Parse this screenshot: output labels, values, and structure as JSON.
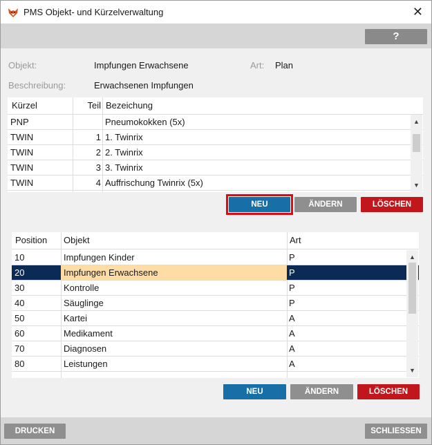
{
  "window": {
    "title": "PMS Objekt- und Kürzelverwaltung",
    "app_icon": "fox-icon",
    "close_label": "✕"
  },
  "toolbar": {
    "help_label": "?"
  },
  "info": {
    "objekt_label": "Objekt:",
    "objekt_value": "Impfungen Erwachsene",
    "art_label": "Art:",
    "art_value": "Plan",
    "beschreibung_label": "Beschreibung:",
    "beschreibung_value": "Erwachsenen Impfungen"
  },
  "kuerzel_table": {
    "columns": {
      "kuerzel": "Kürzel",
      "teil": "Teil",
      "bezeichung": "Bezeichung"
    },
    "rows": [
      {
        "kuerzel": "PNP",
        "teil": "",
        "bezeichung": "Pneumokokken (5x)"
      },
      {
        "kuerzel": "TWIN",
        "teil": "1",
        "bezeichung": "1. Twinrix"
      },
      {
        "kuerzel": "TWIN",
        "teil": "2",
        "bezeichung": "2. Twinrix"
      },
      {
        "kuerzel": "TWIN",
        "teil": "3",
        "bezeichung": "3. Twinrix"
      },
      {
        "kuerzel": "TWIN",
        "teil": "4",
        "bezeichung": "Auffrischung Twinrix (5x)"
      }
    ],
    "buttons": {
      "new": "NEU",
      "edit": "ÄNDERN",
      "delete": "LÖSCHEN"
    }
  },
  "objekt_table": {
    "columns": {
      "position": "Position",
      "objekt": "Objekt",
      "art": "Art"
    },
    "rows": [
      {
        "position": "10",
        "objekt": "Impfungen Kinder",
        "art": "P",
        "selected": false
      },
      {
        "position": "20",
        "objekt": "Impfungen Erwachsene",
        "art": "P",
        "selected": true
      },
      {
        "position": "30",
        "objekt": "Kontrolle",
        "art": "P",
        "selected": false
      },
      {
        "position": "40",
        "objekt": "Säuglinge",
        "art": "P",
        "selected": false
      },
      {
        "position": "50",
        "objekt": "Kartei",
        "art": "A",
        "selected": false
      },
      {
        "position": "60",
        "objekt": "Medikament",
        "art": "A",
        "selected": false
      },
      {
        "position": "70",
        "objekt": "Diagnosen",
        "art": "A",
        "selected": false
      },
      {
        "position": "80",
        "objekt": "Leistungen",
        "art": "A",
        "selected": false
      }
    ],
    "buttons": {
      "new": "NEU",
      "edit": "ÄNDERN",
      "delete": "LÖSCHEN"
    }
  },
  "footer": {
    "print_label": "DRUCKEN",
    "close_label": "SCHLIESSEN"
  },
  "colors": {
    "accent_blue": "#186fa8",
    "delete_red": "#c0161c",
    "disabled_grey": "#8f8f8f",
    "selection_navy": "#0b2a55",
    "selection_highlight": "#fddca6",
    "focus_outline": "#e30613"
  }
}
